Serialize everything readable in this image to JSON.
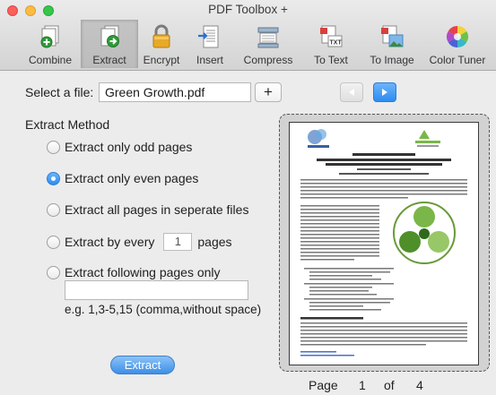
{
  "window": {
    "title": "PDF Toolbox +"
  },
  "toolbar": {
    "items": [
      {
        "label": "Combine",
        "icon": "combine-icon"
      },
      {
        "label": "Extract",
        "icon": "extract-icon"
      },
      {
        "label": "Encrypt",
        "icon": "lock-icon"
      },
      {
        "label": "Insert",
        "icon": "insert-icon"
      },
      {
        "label": "Compress",
        "icon": "compress-icon"
      },
      {
        "label": "To Text",
        "icon": "to-text-icon"
      },
      {
        "label": "To Image",
        "icon": "to-image-icon"
      },
      {
        "label": "Color Tuner",
        "icon": "color-wheel-icon"
      }
    ],
    "active": "Extract"
  },
  "file": {
    "label": "Select a file:",
    "value": "Green Growth.pdf",
    "add_label": "+"
  },
  "method": {
    "title": "Extract Method",
    "options": [
      {
        "label": "Extract only odd pages",
        "selected": false
      },
      {
        "label": "Extract only even pages",
        "selected": true
      },
      {
        "label": "Extract all pages in seperate files",
        "selected": false
      },
      {
        "label": "Extract by every",
        "selected": false
      },
      {
        "label": "Extract following pages only",
        "selected": false
      }
    ],
    "every_value": "1",
    "every_suffix": "pages",
    "pages_value": "",
    "hint": "e.g. 1,3-5,15 (comma,without space)"
  },
  "extract_button": "Extract",
  "preview": {
    "page_label": "Page",
    "current_page": "1",
    "of_label": "of",
    "total_pages": "4",
    "doc": {
      "header1": "International Training on",
      "header2": "\"Green Growth – Policy Measures as a Tool for Local and Regional Sustainable Development\"",
      "header3": "27 July – 03 August 2015",
      "header4": "Organized by the Korea Center for Development Studies",
      "section": "The Developing World Relevance",
      "logo_right": "WHITE CENTRE"
    }
  },
  "colors": {
    "accent": "#2d8cf0",
    "chrome_top": "#ebebeb",
    "chrome_bottom": "#d3d3d3"
  }
}
